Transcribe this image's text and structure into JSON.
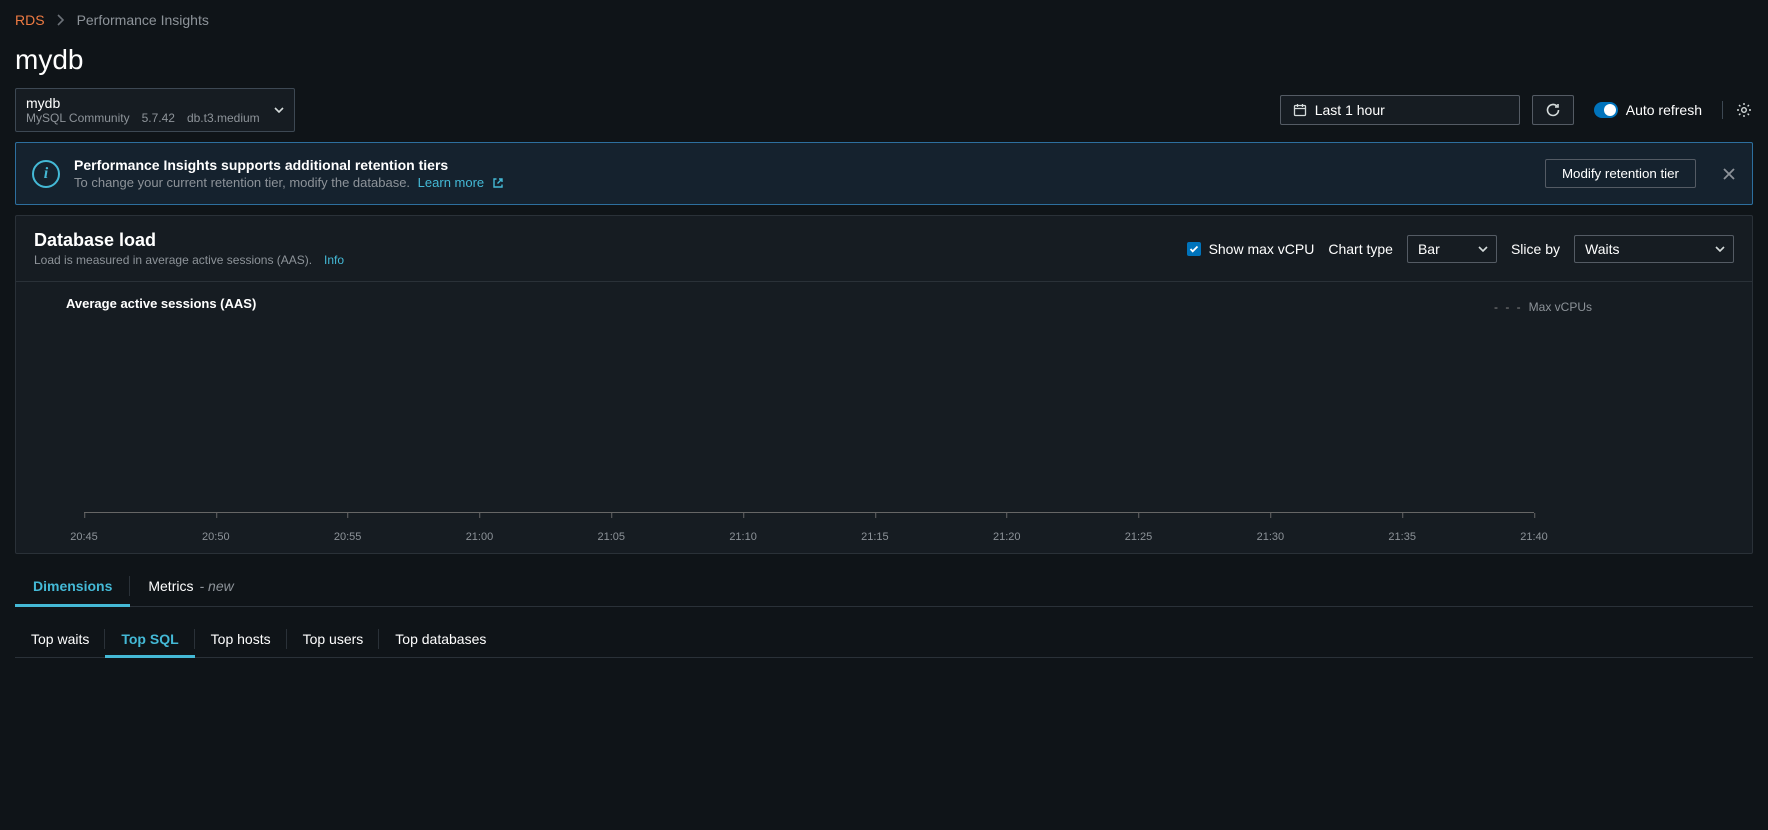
{
  "breadcrumb": {
    "root": "RDS",
    "current": "Performance Insights"
  },
  "page_title": "mydb",
  "db_selector": {
    "name": "mydb",
    "engine": "MySQL Community",
    "version": "5.7.42",
    "instance": "db.t3.medium"
  },
  "time_range": {
    "label": "Last 1 hour"
  },
  "auto_refresh": {
    "label": "Auto refresh",
    "enabled": true
  },
  "banner": {
    "title": "Performance Insights supports additional retention tiers",
    "subtitle": "To change your current retention tier, modify the database.",
    "learn_more": "Learn more",
    "action": "Modify retention tier"
  },
  "chart_panel": {
    "title": "Database load",
    "subtitle": "Load is measured in average active sessions (AAS).",
    "info": "Info",
    "show_max_vcpu": "Show max vCPU",
    "chart_type_label": "Chart type",
    "chart_type_value": "Bar",
    "slice_by_label": "Slice by",
    "slice_by_value": "Waits",
    "series_title": "Average active sessions (AAS)",
    "legend_max_vcpu": "Max vCPUs"
  },
  "chart_data": {
    "type": "bar",
    "title": "Average active sessions (AAS)",
    "xlabel": "",
    "ylabel": "",
    "categories": [
      "20:45",
      "20:50",
      "20:55",
      "21:00",
      "21:05",
      "21:10",
      "21:15",
      "21:20",
      "21:25",
      "21:30",
      "21:35",
      "21:40"
    ],
    "series": [
      {
        "name": "AAS",
        "values": [
          0,
          0,
          0,
          0,
          0,
          0,
          0,
          0,
          0,
          0,
          0,
          0
        ]
      }
    ],
    "reference_lines": [
      {
        "name": "Max vCPUs",
        "style": "dashed"
      }
    ],
    "ylim": [
      0,
      1
    ]
  },
  "tabs": {
    "items": [
      {
        "label": "Dimensions",
        "active": true
      },
      {
        "label": "Metrics",
        "suffix": "- new",
        "active": false
      }
    ]
  },
  "subtabs": {
    "items": [
      {
        "label": "Top waits",
        "active": false
      },
      {
        "label": "Top SQL",
        "active": true
      },
      {
        "label": "Top hosts",
        "active": false
      },
      {
        "label": "Top users",
        "active": false
      },
      {
        "label": "Top databases",
        "active": false
      }
    ]
  }
}
